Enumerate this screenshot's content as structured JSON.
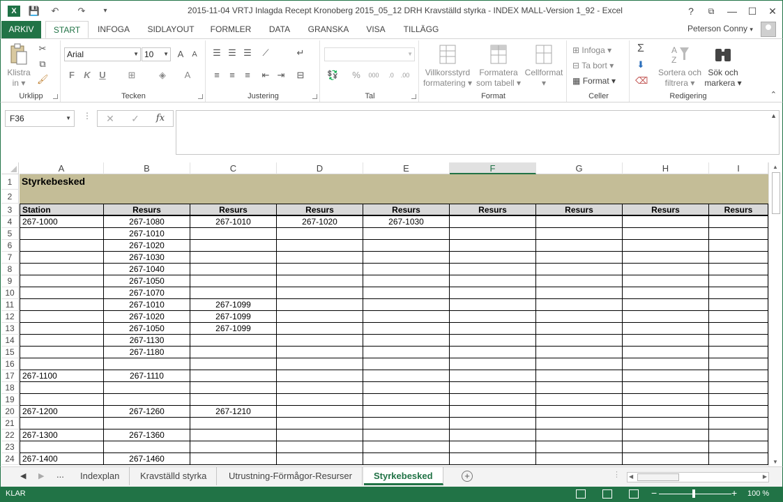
{
  "window": {
    "title": "2015-11-04 VRTJ Inlagda Recept Kronoberg 2015_05_12 DRH Kravställd styrka - INDEX MALL-Version 1_92 - Excel",
    "help": "?",
    "minimize": "—",
    "maximize": "☐",
    "close": "✕",
    "restore": "⧉"
  },
  "qat": {
    "save": "💾",
    "undo": "↶",
    "redo": "↷",
    "more": "▾"
  },
  "tabs": {
    "file": "ARKIV",
    "items": [
      "START",
      "INFOGA",
      "SIDLAYOUT",
      "FORMLER",
      "DATA",
      "GRANSKA",
      "VISA",
      "TILLÄGG"
    ],
    "active": "START"
  },
  "user": {
    "name": "Peterson Conny",
    "arrow": "▾"
  },
  "ribbon": {
    "clipboard": {
      "label": "Urklipp",
      "paste_line1": "Klistra",
      "paste_line2": "in ▾"
    },
    "font": {
      "label": "Tecken",
      "name": "Arial",
      "size": "10",
      "bold": "F",
      "italic": "K",
      "underline": "U"
    },
    "alignment": {
      "label": "Justering"
    },
    "number": {
      "label": "Tal",
      "format": "",
      "percent": "%",
      "thousands": "000"
    },
    "styles": {
      "label": "Format",
      "conditional_line1": "Villkorsstyrd",
      "conditional_line2": "formatering ▾",
      "table_line1": "Formatera",
      "table_line2": "som tabell ▾",
      "cell_styles_line1": "Cellformat",
      "cell_styles_line2": "▾"
    },
    "cells": {
      "label": "Celler",
      "insert": "Infoga ▾",
      "delete": "Ta bort ▾",
      "format": "Format ▾"
    },
    "editing": {
      "label": "Redigering",
      "sort_line1": "Sortera och",
      "sort_line2": "filtrera ▾",
      "find_line1": "Sök och",
      "find_line2": "markera ▾"
    },
    "collapse": "⌃"
  },
  "formula_bar": {
    "name_box": "F36",
    "cancel": "✕",
    "enter": "✓",
    "fx": "fx",
    "value": ""
  },
  "columns": [
    "A",
    "B",
    "C",
    "D",
    "E",
    "F",
    "G",
    "H",
    "I"
  ],
  "selected_column": "F",
  "rows": [
    "1",
    "2",
    "3",
    "4",
    "5",
    "6",
    "7",
    "8",
    "9",
    "10",
    "11",
    "12",
    "13",
    "14",
    "15",
    "16",
    "17",
    "18",
    "19",
    "20",
    "21",
    "22",
    "23",
    "24"
  ],
  "sheet": {
    "title": "Styrkebesked",
    "header": [
      "Station",
      "Resurs",
      "Resurs",
      "Resurs",
      "Resurs",
      "Resurs",
      "Resurs",
      "Resurs",
      "Resurs"
    ],
    "data": [
      [
        "267-1000",
        "267-1080",
        "267-1010",
        "267-1020",
        "267-1030",
        "",
        "",
        "",
        ""
      ],
      [
        "",
        "267-1010",
        "",
        "",
        "",
        "",
        "",
        "",
        ""
      ],
      [
        "",
        "267-1020",
        "",
        "",
        "",
        "",
        "",
        "",
        ""
      ],
      [
        "",
        "267-1030",
        "",
        "",
        "",
        "",
        "",
        "",
        ""
      ],
      [
        "",
        "267-1040",
        "",
        "",
        "",
        "",
        "",
        "",
        ""
      ],
      [
        "",
        "267-1050",
        "",
        "",
        "",
        "",
        "",
        "",
        ""
      ],
      [
        "",
        "267-1070",
        "",
        "",
        "",
        "",
        "",
        "",
        ""
      ],
      [
        "",
        "267-1010",
        "267-1099",
        "",
        "",
        "",
        "",
        "",
        ""
      ],
      [
        "",
        "267-1020",
        "267-1099",
        "",
        "",
        "",
        "",
        "",
        ""
      ],
      [
        "",
        "267-1050",
        "267-1099",
        "",
        "",
        "",
        "",
        "",
        ""
      ],
      [
        "",
        "267-1130",
        "",
        "",
        "",
        "",
        "",
        "",
        ""
      ],
      [
        "",
        "267-1180",
        "",
        "",
        "",
        "",
        "",
        "",
        ""
      ],
      [
        "",
        "",
        "",
        "",
        "",
        "",
        "",
        "",
        ""
      ],
      [
        "267-1100",
        "267-1110",
        "",
        "",
        "",
        "",
        "",
        "",
        ""
      ],
      [
        "",
        "",
        "",
        "",
        "",
        "",
        "",
        "",
        ""
      ],
      [
        "",
        "",
        "",
        "",
        "",
        "",
        "",
        "",
        ""
      ],
      [
        "267-1200",
        "267-1260",
        "267-1210",
        "",
        "",
        "",
        "",
        "",
        ""
      ],
      [
        "",
        "",
        "",
        "",
        "",
        "",
        "",
        "",
        ""
      ],
      [
        "267-1300",
        "267-1360",
        "",
        "",
        "",
        "",
        "",
        "",
        ""
      ],
      [
        "",
        "",
        "",
        "",
        "",
        "",
        "",
        "",
        ""
      ],
      [
        "267-1400",
        "267-1460",
        "",
        "",
        "",
        "",
        "",
        "",
        ""
      ]
    ]
  },
  "sheet_tabs": {
    "nav_prev": "◀",
    "nav_next": "▶",
    "more": "...",
    "items": [
      "Indexplan",
      "Kravställd styrka",
      "Utrustning-Förmågor-Resurser",
      "Styrkebesked"
    ],
    "active": "Styrkebesked",
    "add": "+"
  },
  "status": {
    "text": "KLAR",
    "zoom": "100 %",
    "zoom_minus": "−",
    "zoom_plus": "+"
  },
  "colors": {
    "accent": "#217346",
    "title_band": "#c4bd97",
    "header_band": "#d9d9d9"
  }
}
